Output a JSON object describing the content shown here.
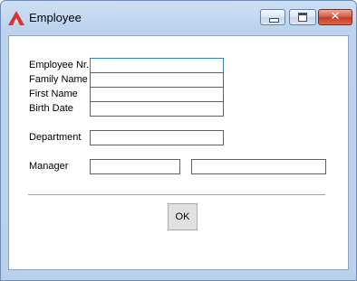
{
  "window": {
    "title": "Employee",
    "app_icon": "red-delta-logo-icon",
    "controls": {
      "minimize": "minimize-icon",
      "maximize": "maximize-icon",
      "close": "close-icon"
    },
    "close_glyph": "✕"
  },
  "form": {
    "employee_nr": {
      "label": "Employee Nr.",
      "value": ""
    },
    "family_name": {
      "label": "Family Name",
      "value": ""
    },
    "first_name": {
      "label": "First Name",
      "value": ""
    },
    "birth_date": {
      "label": "Birth Date",
      "value": ""
    },
    "department": {
      "label": "Department",
      "value": ""
    },
    "manager": {
      "label": "Manager",
      "value_id": "",
      "value_name": ""
    }
  },
  "buttons": {
    "ok_label": "OK"
  },
  "colors": {
    "titlebar": "#bcd3ee",
    "close_button": "#c23a22",
    "focus_border": "#3c7fb1",
    "app_icon": "#e03030"
  }
}
